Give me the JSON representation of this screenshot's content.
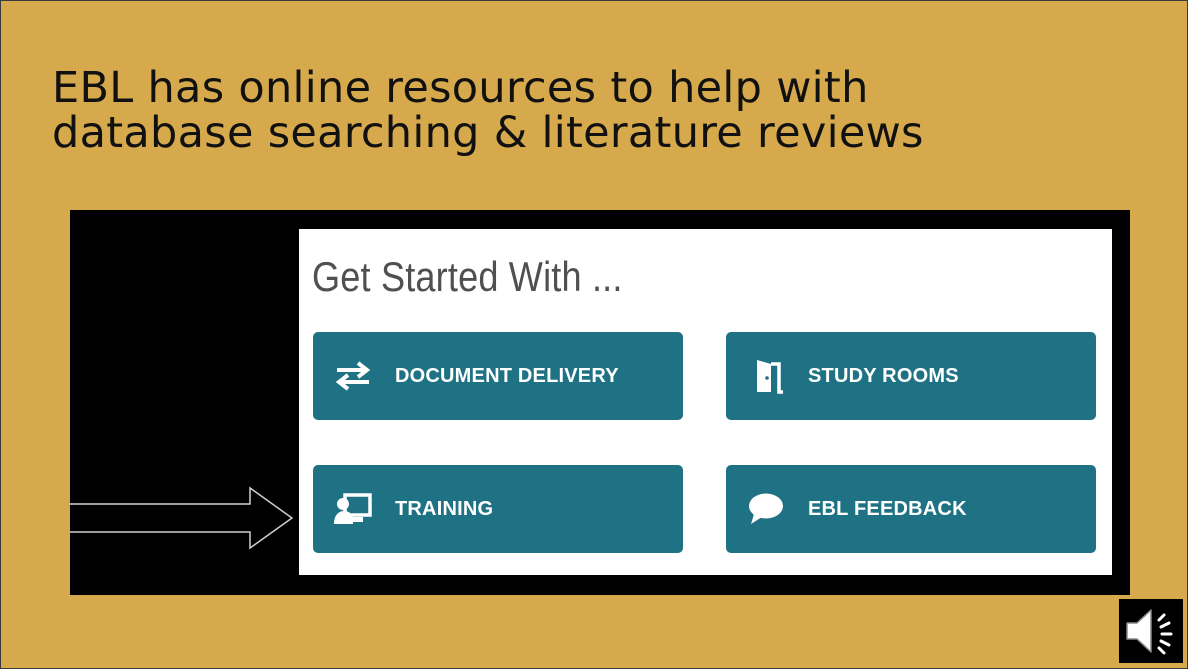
{
  "slide": {
    "title_line1": "EBL has online resources to help with",
    "title_line2": "database searching & literature reviews"
  },
  "panel": {
    "heading": "Get Started With ...",
    "tiles": [
      {
        "label": "DOCUMENT DELIVERY",
        "icon": "transfer-arrows-icon"
      },
      {
        "label": "STUDY ROOMS",
        "icon": "door-icon"
      },
      {
        "label": "TRAINING",
        "icon": "presentation-icon"
      },
      {
        "label": "EBL FEEDBACK",
        "icon": "speech-bubble-icon"
      }
    ]
  },
  "colors": {
    "slide_background": "#d6aa4c",
    "tile_background": "#1e7284",
    "tile_text": "#ffffff"
  },
  "audio": {
    "icon": "speaker-icon"
  }
}
